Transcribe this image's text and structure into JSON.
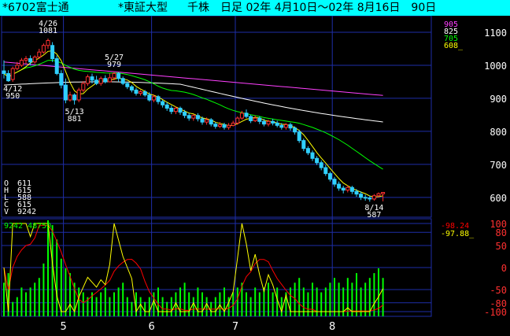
{
  "header": {
    "stock": "*6702富士通",
    "index": "*東証大型",
    "period": "千株　日足 02年 4月10日～02年 8月16日　90日"
  },
  "colors": {
    "background": "#000000",
    "title_bar": "#00ffff",
    "grid": "#1e2ea8",
    "axis_text": "#ffffff",
    "candle_up": "#ff3030",
    "candle_down": "#30d0ff",
    "ma5": "#ffff00",
    "ma25": "#00ff00",
    "ma75": "#ffffff",
    "ma200": "#ff40ff",
    "volume": "#00ff00",
    "osc_fast": "#ffff00",
    "osc_slow": "#ff0000"
  },
  "legend": {
    "ma_values": [
      "905",
      "825",
      "705",
      "608_"
    ],
    "ohlc": [
      {
        "k": "O",
        "v": "611"
      },
      {
        "k": "H",
        "v": "615"
      },
      {
        "k": "L",
        "v": "588"
      },
      {
        "k": "C",
        "v": "615"
      },
      {
        "k": "V",
        "v": "9242"
      }
    ],
    "volume_text": "9242  48750",
    "osc_values": [
      "-98.24",
      "-97.88_"
    ]
  },
  "annotations": [
    {
      "date": "4/12",
      "value": "950"
    },
    {
      "date": "4/26",
      "value": "1081"
    },
    {
      "date": "5/13",
      "value": "881"
    },
    {
      "date": "5/27",
      "value": "979"
    },
    {
      "date": "8/14",
      "value": "587"
    }
  ],
  "chart_data": {
    "type": "candlestick",
    "price_axis": {
      "ticks": [
        600,
        700,
        800,
        900,
        1000,
        1100
      ],
      "ylim": [
        540,
        1150
      ]
    },
    "osc_axis": {
      "ticks": [
        100,
        80,
        50,
        0,
        -50,
        -80,
        -100
      ],
      "ylim": [
        -100,
        100
      ]
    },
    "month_labels": [
      "5",
      "6",
      "7",
      "8"
    ],
    "month_start_index": [
      14,
      34,
      53,
      75
    ],
    "candles": [
      [
        983,
        975,
        1015,
        960
      ],
      [
        975,
        953,
        985,
        950
      ],
      [
        957,
        990,
        996,
        950
      ],
      [
        990,
        1000,
        1010,
        985
      ],
      [
        1000,
        1015,
        1022,
        995
      ],
      [
        1015,
        1020,
        1028,
        1005
      ],
      [
        1020,
        1010,
        1030,
        1000
      ],
      [
        1010,
        1025,
        1030,
        1005
      ],
      [
        1025,
        1040,
        1050,
        1020
      ],
      [
        1040,
        1060,
        1066,
        1035
      ],
      [
        1060,
        1075,
        1081,
        1050
      ],
      [
        1060,
        1020,
        1070,
        1010
      ],
      [
        1020,
        975,
        1030,
        970
      ],
      [
        975,
        940,
        985,
        930
      ],
      [
        940,
        895,
        960,
        885
      ],
      [
        895,
        910,
        920,
        890
      ],
      [
        910,
        895,
        915,
        881
      ],
      [
        895,
        925,
        932,
        888
      ],
      [
        925,
        945,
        952,
        918
      ],
      [
        945,
        965,
        972,
        938
      ],
      [
        965,
        955,
        975,
        945
      ],
      [
        955,
        945,
        968,
        940
      ],
      [
        945,
        960,
        966,
        938
      ],
      [
        960,
        950,
        970,
        945
      ],
      [
        950,
        962,
        975,
        948
      ],
      [
        962,
        975,
        979,
        955
      ],
      [
        975,
        960,
        979,
        950
      ],
      [
        960,
        945,
        966,
        940
      ],
      [
        945,
        935,
        950,
        928
      ],
      [
        935,
        925,
        940,
        918
      ],
      [
        925,
        915,
        932,
        908
      ],
      [
        915,
        920,
        925,
        908
      ],
      [
        920,
        910,
        925,
        905
      ],
      [
        910,
        895,
        918,
        890
      ],
      [
        895,
        905,
        912,
        888
      ],
      [
        905,
        890,
        910,
        882
      ],
      [
        890,
        880,
        895,
        872
      ],
      [
        880,
        870,
        888,
        862
      ],
      [
        870,
        860,
        878,
        852
      ],
      [
        860,
        870,
        875,
        852
      ],
      [
        870,
        858,
        875,
        850
      ],
      [
        858,
        848,
        865,
        840
      ],
      [
        848,
        840,
        855,
        832
      ],
      [
        840,
        848,
        852,
        832
      ],
      [
        848,
        838,
        855,
        830
      ],
      [
        838,
        828,
        845,
        820
      ],
      [
        828,
        835,
        842,
        820
      ],
      [
        835,
        822,
        840,
        815
      ],
      [
        822,
        815,
        828,
        808
      ],
      [
        815,
        820,
        828,
        810
      ],
      [
        820,
        812,
        826,
        805
      ],
      [
        812,
        818,
        825,
        805
      ],
      [
        818,
        825,
        832,
        815
      ],
      [
        825,
        840,
        845,
        820
      ],
      [
        840,
        855,
        862,
        835
      ],
      [
        855,
        845,
        866,
        840
      ],
      [
        845,
        832,
        850,
        825
      ],
      [
        832,
        840,
        848,
        828
      ],
      [
        840,
        830,
        846,
        822
      ],
      [
        830,
        822,
        838,
        815
      ],
      [
        822,
        830,
        835,
        815
      ],
      [
        830,
        825,
        838,
        818
      ],
      [
        825,
        818,
        832,
        812
      ],
      [
        818,
        812,
        825,
        805
      ],
      [
        812,
        820,
        825,
        805
      ],
      [
        820,
        810,
        826,
        802
      ],
      [
        810,
        798,
        815,
        790
      ],
      [
        798,
        772,
        805,
        765
      ],
      [
        772,
        748,
        778,
        740
      ],
      [
        748,
        735,
        755,
        728
      ],
      [
        735,
        718,
        742,
        710
      ],
      [
        718,
        705,
        725,
        698
      ],
      [
        705,
        690,
        712,
        682
      ],
      [
        690,
        672,
        698,
        665
      ],
      [
        672,
        655,
        678,
        648
      ],
      [
        655,
        640,
        662,
        632
      ],
      [
        640,
        628,
        648,
        620
      ],
      [
        628,
        622,
        635,
        612
      ],
      [
        622,
        630,
        636,
        615
      ],
      [
        630,
        618,
        635,
        610
      ],
      [
        618,
        610,
        625,
        602
      ],
      [
        610,
        600,
        618,
        592
      ],
      [
        600,
        598,
        608,
        590
      ],
      [
        598,
        595,
        605,
        587
      ],
      [
        595,
        605,
        610,
        590
      ],
      [
        605,
        611,
        615,
        600
      ],
      [
        611,
        615,
        615,
        588
      ]
    ],
    "volume_relative": [
      0.35,
      0.45,
      0.15,
      0.2,
      0.3,
      0.25,
      0.3,
      0.35,
      0.4,
      0.55,
      1.0,
      0.95,
      0.8,
      0.6,
      0.5,
      0.45,
      0.35,
      0.3,
      0.25,
      0.2,
      0.25,
      0.2,
      0.25,
      0.3,
      0.2,
      0.25,
      0.3,
      0.35,
      0.2,
      0.15,
      0.25,
      0.2,
      0.15,
      0.2,
      0.25,
      0.3,
      0.2,
      0.15,
      0.2,
      0.25,
      0.3,
      0.35,
      0.25,
      0.2,
      0.3,
      0.25,
      0.2,
      0.15,
      0.2,
      0.25,
      0.3,
      0.2,
      0.25,
      0.3,
      0.35,
      0.25,
      0.2,
      0.3,
      0.25,
      0.3,
      0.35,
      0.25,
      0.3,
      0.2,
      0.25,
      0.3,
      0.35,
      0.4,
      0.3,
      0.25,
      0.35,
      0.3,
      0.25,
      0.3,
      0.35,
      0.4,
      0.35,
      0.3,
      0.4,
      0.35,
      0.45,
      0.3,
      0.35,
      0.4,
      0.45,
      0.5,
      0.4
    ]
  }
}
